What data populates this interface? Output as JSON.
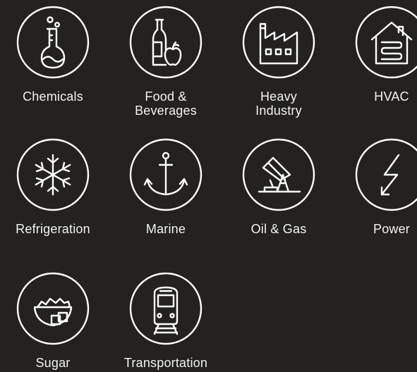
{
  "industries": [
    {
      "label": "Chemicals",
      "icon": "flask-icon"
    },
    {
      "label": "Food &\nBeverages",
      "icon": "bottle-apple-icon"
    },
    {
      "label": "Heavy\nIndustry",
      "icon": "factory-icon"
    },
    {
      "label": "HVAC",
      "icon": "house-coil-icon"
    },
    {
      "label": "Refrigeration",
      "icon": "snowflake-icon"
    },
    {
      "label": "Marine",
      "icon": "anchor-icon"
    },
    {
      "label": "Oil & Gas",
      "icon": "pumpjack-icon"
    },
    {
      "label": "Power",
      "icon": "lightning-bolt-icon"
    },
    {
      "label": "Sugar",
      "icon": "sugar-bowl-icon"
    },
    {
      "label": "Transportation",
      "icon": "train-icon"
    }
  ],
  "colors": {
    "background": "#232220",
    "foreground": "#ffffff"
  }
}
